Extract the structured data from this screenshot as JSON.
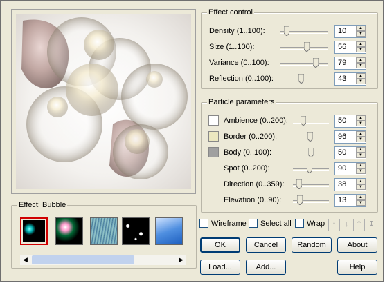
{
  "effect_control": {
    "title": "Effect control",
    "rows": [
      {
        "label": "Density (1..100):",
        "value": "10",
        "slider_fraction": 0.09
      },
      {
        "label": "Size (1..100):",
        "value": "56",
        "slider_fraction": 0.56
      },
      {
        "label": "Variance (0..100):",
        "value": "79",
        "slider_fraction": 0.79
      },
      {
        "label": "Reflection (0..100):",
        "value": "43",
        "slider_fraction": 0.43
      }
    ]
  },
  "particle_parameters": {
    "title": "Particle parameters",
    "rows": [
      {
        "label": "Ambience (0..200):",
        "value": "50",
        "slider_fraction": 0.25,
        "swatch": "#ffffff"
      },
      {
        "label": "Border (0..200):",
        "value": "96",
        "slider_fraction": 0.48,
        "swatch": "#ebe7c0"
      },
      {
        "label": "Body (0..100):",
        "value": "50",
        "slider_fraction": 0.5,
        "swatch": "#a0a0a0"
      },
      {
        "label": "Spot (0..200):",
        "value": "90",
        "slider_fraction": 0.45
      },
      {
        "label": "Direction (0..359):",
        "value": "38",
        "slider_fraction": 0.11
      },
      {
        "label": "Elevation (0..90):",
        "value": "13",
        "slider_fraction": 0.14
      }
    ]
  },
  "effect_group": {
    "title": "Effect: Bubble",
    "thumbnails": [
      "bubble",
      "sparkle",
      "rain",
      "stars",
      "sky"
    ],
    "selected_index": 0
  },
  "options": {
    "wireframe": "Wireframe",
    "select_all": "Select all",
    "wrap": "Wrap"
  },
  "arrows": [
    "up-icon",
    "down-icon",
    "top-icon",
    "bottom-icon"
  ],
  "buttons": {
    "ok": "OK",
    "cancel": "Cancel",
    "random": "Random",
    "about": "About",
    "load": "Load...",
    "add": "Add...",
    "help": "Help"
  },
  "colors": {
    "dialog_bg": "#ece9d8",
    "selection": "#d00000",
    "field_border": "#7f9db9"
  }
}
